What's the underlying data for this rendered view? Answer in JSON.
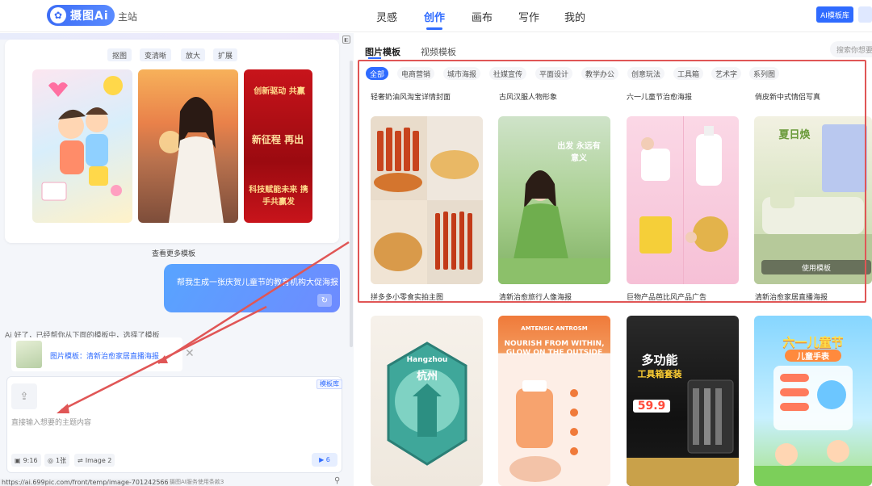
{
  "topbar": {
    "logo_text": "摄图Ai",
    "logo_sub": "主站",
    "nav": [
      "灵感",
      "创作",
      "画布",
      "写作",
      "我的"
    ],
    "active_nav": "创作",
    "ai_lib_button": "AI模板库"
  },
  "left": {
    "chips": [
      "抠图",
      "变清晰",
      "放大",
      "扩展"
    ],
    "thumb3_lines": [
      "创新驱动 共赢",
      "新征程 再出",
      "科技赋能未来 携手共赢发"
    ],
    "see_more": "查看更多模板",
    "user_message": "帮我生成一张庆贺儿童节的教育机构大促海报",
    "reply_partial": "Ai 好了，已经帮你从下面的模板中，选择了模板",
    "attachment_label": "图片模板：清新治愈家居直播海报",
    "template_lib_tag": "模板库",
    "input_placeholder": "直接输入想要的主题内容",
    "options": {
      "ratio": "9:16",
      "count": "1张",
      "model": "Image 2",
      "send_count": "6"
    },
    "status_url": "https://ai.699pic.com/front/temp/image-701242566",
    "status_note": "摄图AI服务使用条款3"
  },
  "right": {
    "tabs": [
      "图片模板",
      "视频模板"
    ],
    "active_tab": "图片模板",
    "search_placeholder": "搜索你想要",
    "categories": [
      "全部",
      "电商营销",
      "城市海报",
      "社媒宣传",
      "平面设计",
      "教学办公",
      "创意玩法",
      "工具箱",
      "艺术字",
      "系列图"
    ],
    "active_category": "全部",
    "row1_labels": [
      "轻奢奶油风淘宝详情封面",
      "古风汉服人物形象",
      "六一儿童节治愈海报",
      "俏皮新中式情侣写真"
    ],
    "row2_labels": [
      "拼多多小零食实拍主图",
      "清新治愈旅行人像海报",
      "巨物产品芭比风产品广告",
      "清新治愈家居直播海报"
    ],
    "use_template_button": "使用模板",
    "card_texts": {
      "travel": "出发 永远有意义",
      "home": "夏日焕",
      "hangzhou_top": "Hangzhou",
      "hangzhou_main": "杭州",
      "antrosm_brand": "AMTENSIC ANTROSM",
      "antrosm_headline": "NOURISH FROM WITHIN, GLOW ON THE OUTSIDE",
      "tools_title": "多功能",
      "tools_title2": "工具箱套装",
      "tools_price": "59.9",
      "kids_title": "六一儿童节",
      "kids_sub": "儿童手表"
    }
  },
  "colors": {
    "accent": "#2f6bff",
    "highlight_frame": "#e05656"
  }
}
